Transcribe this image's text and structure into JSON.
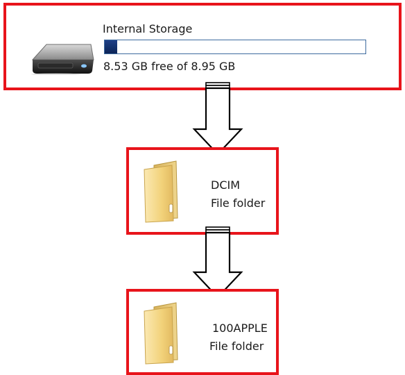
{
  "drive": {
    "name": "Internal Storage",
    "free_text": "8.53 GB free of 8.95 GB",
    "icon": "hard-drive-icon",
    "used_fraction": 0.047
  },
  "folders": [
    {
      "name": "DCIM",
      "type": "File folder",
      "icon": "folder-icon"
    },
    {
      "name": "100APPLE",
      "type": "File folder",
      "icon": "folder-icon"
    }
  ],
  "colors": {
    "highlight_border": "#e8141b",
    "capacity_fill": "#14336f",
    "capacity_border": "#3c6a9e",
    "folder_yellow": "#f2d27a"
  }
}
